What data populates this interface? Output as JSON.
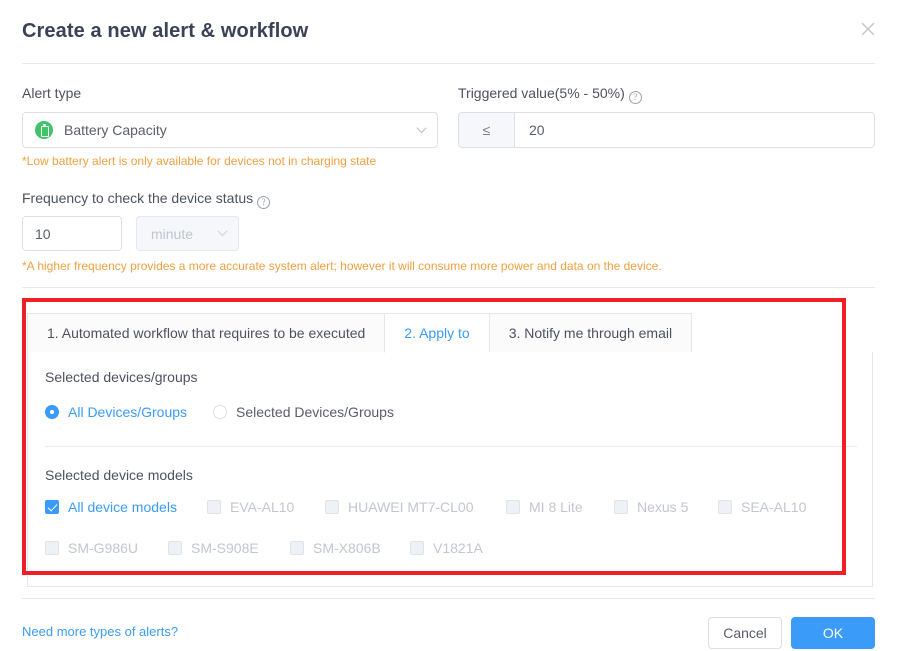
{
  "dialog": {
    "title": "Create a new alert & workflow",
    "close_icon": "close-icon"
  },
  "alert_type": {
    "label": "Alert type",
    "selected": "Battery Capacity",
    "icon": "battery-icon",
    "icon_color": "#3fc46a",
    "warning": "*Low battery alert is only available for devices not in charging state"
  },
  "triggered_value": {
    "label": "Triggered value(5% - 50%)",
    "help_icon": "question-mark-icon",
    "operator": "≤",
    "value": "20",
    "placeholder": "20"
  },
  "frequency": {
    "label": "Frequency to check the device status",
    "help_icon": "question-mark-icon",
    "value": "10",
    "placeholder": "10",
    "unit": "minute",
    "warning": "*A higher frequency provides a more accurate system alert; however it will consume more power and data on the device."
  },
  "tabs": [
    {
      "label": "1. Automated workflow that requires to be executed",
      "active": false
    },
    {
      "label": "2. Apply to",
      "active": true
    },
    {
      "label": "3. Notify me through email",
      "active": false
    }
  ],
  "apply_to": {
    "devices_groups": {
      "label": "Selected devices/groups",
      "options": [
        {
          "label": "All Devices/Groups",
          "checked": true
        },
        {
          "label": "Selected Devices/Groups",
          "checked": false
        }
      ]
    },
    "device_models": {
      "label": "Selected device models",
      "options": [
        {
          "label": "All device models",
          "checked": true,
          "disabled": false
        },
        {
          "label": "EVA-AL10",
          "checked": false,
          "disabled": true
        },
        {
          "label": "HUAWEI MT7-CL00",
          "checked": false,
          "disabled": true
        },
        {
          "label": "MI 8 Lite",
          "checked": false,
          "disabled": true
        },
        {
          "label": "Nexus 5",
          "checked": false,
          "disabled": true
        },
        {
          "label": "SEA-AL10",
          "checked": false,
          "disabled": true
        },
        {
          "label": "SM-G986U",
          "checked": false,
          "disabled": true
        },
        {
          "label": "SM-S908E",
          "checked": false,
          "disabled": true
        },
        {
          "label": "SM-X806B",
          "checked": false,
          "disabled": true
        },
        {
          "label": "V1821A",
          "checked": false,
          "disabled": true
        }
      ]
    }
  },
  "footer": {
    "more_alerts_link": "Need more types of alerts?",
    "cancel_label": "Cancel",
    "ok_label": "OK"
  },
  "annotation": {
    "highlight_color": "#ee2025"
  }
}
